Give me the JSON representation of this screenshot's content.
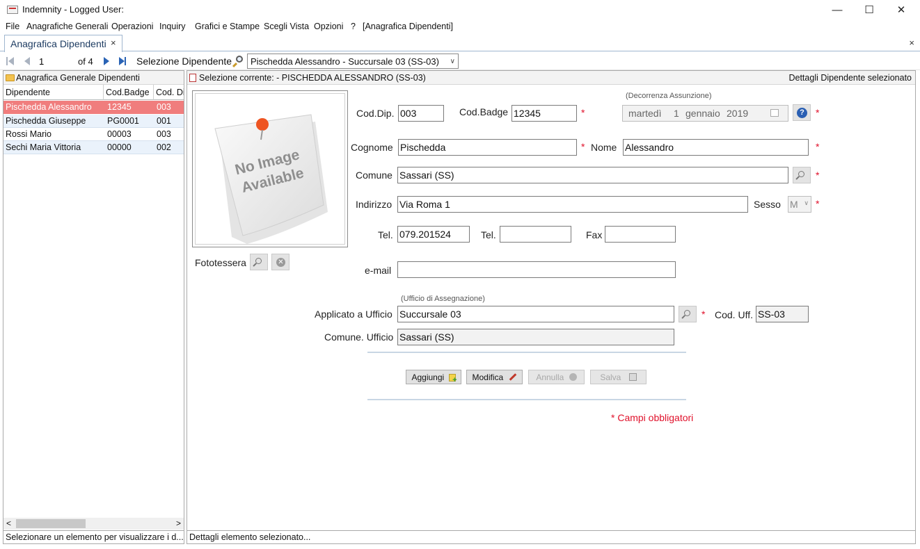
{
  "window": {
    "title": "Indemnity - Logged User:",
    "minimize": "—",
    "maximize": "☐",
    "close": "✕"
  },
  "menu": [
    "File",
    "Anagrafiche Generali",
    "Operazioni",
    "Inquiry",
    "Grafici e Stampe",
    "Scegli Vista",
    "Opzioni",
    "?",
    "[Anagrafica Dipendenti]"
  ],
  "tab": {
    "label": "Anagrafica Dipendenti",
    "close": "×",
    "close_all": "×"
  },
  "navigator": {
    "position": "1",
    "of_count": "of 4",
    "select_label": "Selezione Dipendente",
    "selected_value": "Pischedda Alessandro - Succursale 03 (SS-03)"
  },
  "left_panel": {
    "header": "Anagrafica Generale  Dipendenti",
    "columns": [
      "Dipendente",
      "Cod.Badge",
      "Cod. Di"
    ],
    "rows": [
      {
        "name": "Pischedda Alessandro",
        "badge": "12345",
        "dip": "003"
      },
      {
        "name": "Pischedda Giuseppe",
        "badge": "PG0001",
        "dip": "001"
      },
      {
        "name": "Rossi Mario",
        "badge": "00003",
        "dip": "003"
      },
      {
        "name": "Sechi Maria Vittoria",
        "badge": "00000",
        "dip": "002"
      }
    ],
    "status": "Selezionare un elemento per visualizzare i d..."
  },
  "right_panel": {
    "header": "Selezione corrente:  - PISCHEDDA ALESSANDRO  (SS-03)",
    "header_right": "Dettagli Dipendente selezionato",
    "status": "Dettagli elemento selezionato..."
  },
  "photo": {
    "line1": "No Image",
    "line2": "Available",
    "label": "Fototessera"
  },
  "form": {
    "cod_dip_label": "Cod.Dip.",
    "cod_dip": "003",
    "cod_badge_label": "Cod.Badge",
    "cod_badge": "12345",
    "decorrenza_caption": "(Decorrenza Assunzione)",
    "date_weekday": "martedì",
    "date_day": "1",
    "date_month": "gennaio",
    "date_year": "2019",
    "cognome_label": "Cognome",
    "cognome": "Pischedda",
    "nome_label": "Nome",
    "nome": "Alessandro",
    "comune_label": "Comune",
    "comune": "Sassari (SS)",
    "indirizzo_label": "Indirizzo",
    "indirizzo": "Via Roma 1",
    "sesso_label": "Sesso",
    "sesso": "M",
    "tel_label": "Tel.",
    "tel": "079.201524",
    "tel2_label": "Tel.",
    "tel2": "",
    "fax_label": "Fax",
    "fax": "",
    "email_label": "e-mail",
    "email": "",
    "ufficio_caption": "(Ufficio di Assegnazione)",
    "ufficio_label": "Applicato a Ufficio",
    "ufficio": "Succursale 03",
    "cod_uff_label": "Cod. Uff.",
    "cod_uff": "SS-03",
    "comune_uff_label": "Comune. Ufficio",
    "comune_uff": "Sassari (SS)",
    "required_mark": "*",
    "required_note": "* Campi obbligatori"
  },
  "actions": {
    "add": "Aggiungi",
    "edit": "Modifica",
    "cancel": "Annulla",
    "save": "Salva"
  },
  "colors": {
    "selected_row": "#f07d7d",
    "accent": "#2a63b5",
    "required": "#e0102a"
  }
}
